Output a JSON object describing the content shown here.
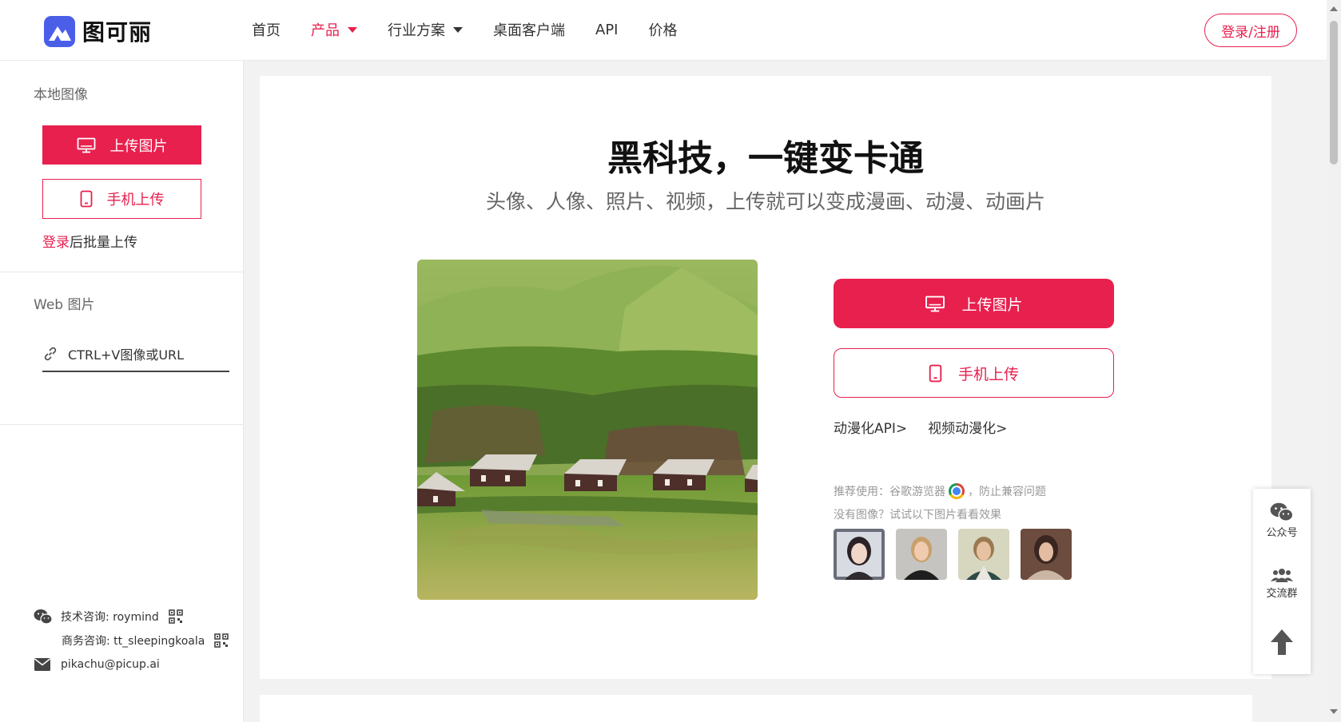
{
  "header": {
    "logo_text": "图可丽",
    "nav": [
      {
        "label": "首页"
      },
      {
        "label": "产品"
      },
      {
        "label": "行业方案"
      },
      {
        "label": "桌面客户端"
      },
      {
        "label": "API"
      },
      {
        "label": "价格"
      }
    ],
    "login_label": "登录/注册"
  },
  "sidebar": {
    "local_title": "本地图像",
    "upload_label": "上传图片",
    "mobile_label": "手机上传",
    "login_link": "登录",
    "batch_text": "后批量上传",
    "web_title": "Web 图片",
    "url_placeholder": "CTRL+V图像或URL",
    "tech_contact": "技术咨询: roymind",
    "biz_contact": "商务咨询: tt_sleepingkoala",
    "email": "pikachu@picup.ai"
  },
  "main": {
    "title": "黑科技，一键变卡通",
    "subtitle": "头像、人像、照片、视频，上传就可以变成漫画、动漫、动画片",
    "upload_label": "上传图片",
    "mobile_label": "手机上传",
    "api_link": "动漫化API>",
    "video_link": "视频动漫化>",
    "recommend_prefix": "推荐使用：谷歌游览器",
    "recommend_suffix": "，防止兼容问题",
    "no_image_text": "没有图像？试试以下图片看看效果"
  },
  "float": {
    "wechat_label": "公众号",
    "group_label": "交流群"
  },
  "colors": {
    "accent": "#e8204e",
    "logo": "#4a5ee8"
  }
}
